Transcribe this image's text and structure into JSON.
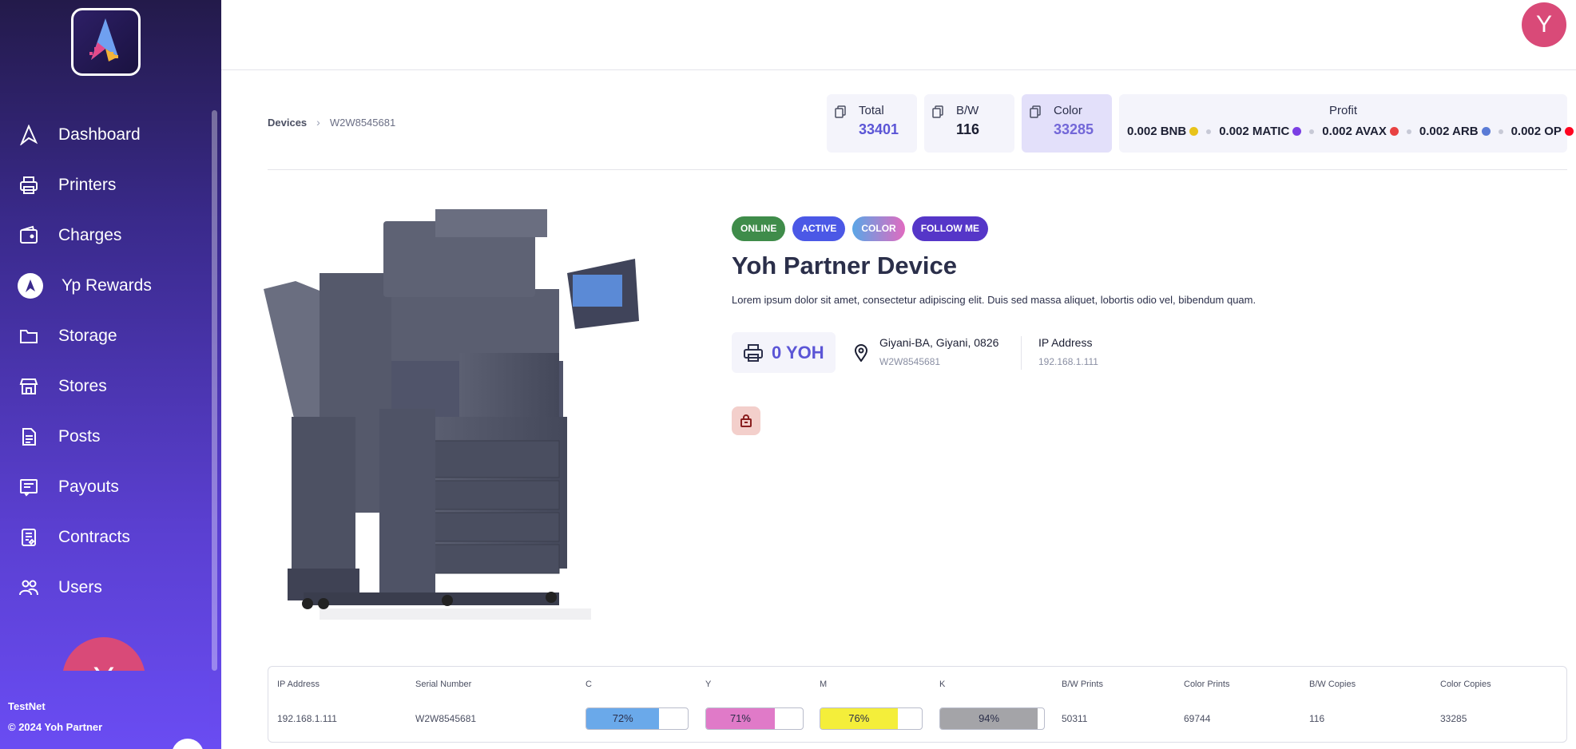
{
  "sidebar": {
    "items": [
      {
        "label": "Dashboard",
        "icon": "dashboard-logo-icon"
      },
      {
        "label": "Printers",
        "icon": "printer-icon"
      },
      {
        "label": "Charges",
        "icon": "wallet-icon"
      },
      {
        "label": "Yp Rewards",
        "icon": "rewards-icon"
      },
      {
        "label": "Storage",
        "icon": "folder-icon"
      },
      {
        "label": "Stores",
        "icon": "store-icon"
      },
      {
        "label": "Posts",
        "icon": "document-icon"
      },
      {
        "label": "Payouts",
        "icon": "receipt-icon"
      },
      {
        "label": "Contracts",
        "icon": "contract-icon"
      },
      {
        "label": "Users",
        "icon": "users-icon"
      }
    ],
    "avatar_initial": "Y",
    "network": "TestNet",
    "copyright": "© 2024 Yoh Partner"
  },
  "header": {
    "avatar_initial": "Y"
  },
  "breadcrumb": {
    "root": "Devices",
    "current": "W2W8545681"
  },
  "stats": {
    "total": {
      "label": "Total",
      "value": "33401"
    },
    "bw": {
      "label": "B/W",
      "value": "116"
    },
    "color": {
      "label": "Color",
      "value": "33285"
    },
    "profit": {
      "label": "Profit",
      "items": [
        {
          "text": "0.002 BNB",
          "color": "#e8c31a"
        },
        {
          "text": "0.002 MATIC",
          "color": "#7b3fe4"
        },
        {
          "text": "0.002 AVAX",
          "color": "#e84142"
        },
        {
          "text": "0.002 ARB",
          "color": "#5a7bd6"
        },
        {
          "text": "0.002 OP",
          "color": "#ff0420"
        }
      ]
    }
  },
  "device": {
    "badges": [
      "ONLINE",
      "ACTIVE",
      "COLOR",
      "FOLLOW ME"
    ],
    "title": "Yoh Partner Device",
    "description": "Lorem ipsum dolor sit amet, consectetur adipiscing elit. Duis sed massa aliquet, lobortis odio vel, bibendum quam.",
    "yoh": "0 YOH",
    "location": "Giyani-BA, Giyani, 0826",
    "serial": "W2W8545681",
    "ip_label": "IP Address",
    "ip": "192.168.1.111"
  },
  "table": {
    "headers": [
      "IP Address",
      "Serial Number",
      "C",
      "Y",
      "M",
      "K",
      "B/W Prints",
      "Color Prints",
      "B/W Copies",
      "Color Copies"
    ],
    "row": {
      "ip": "192.168.1.111",
      "serial": "W2W8545681",
      "c": "72%",
      "y": "71%",
      "m": "76%",
      "k": "94%",
      "bw_prints": "50311",
      "color_prints": "69744",
      "bw_copies": "116",
      "color_copies": "33285"
    },
    "levels": {
      "c": 0.72,
      "y": 0.71,
      "m": 0.76,
      "k": 0.94
    },
    "level_colors": {
      "c": "#6aa9ea",
      "y": "#e07ac8",
      "m": "#f4ee3a",
      "k": "#a4a4a8"
    }
  }
}
